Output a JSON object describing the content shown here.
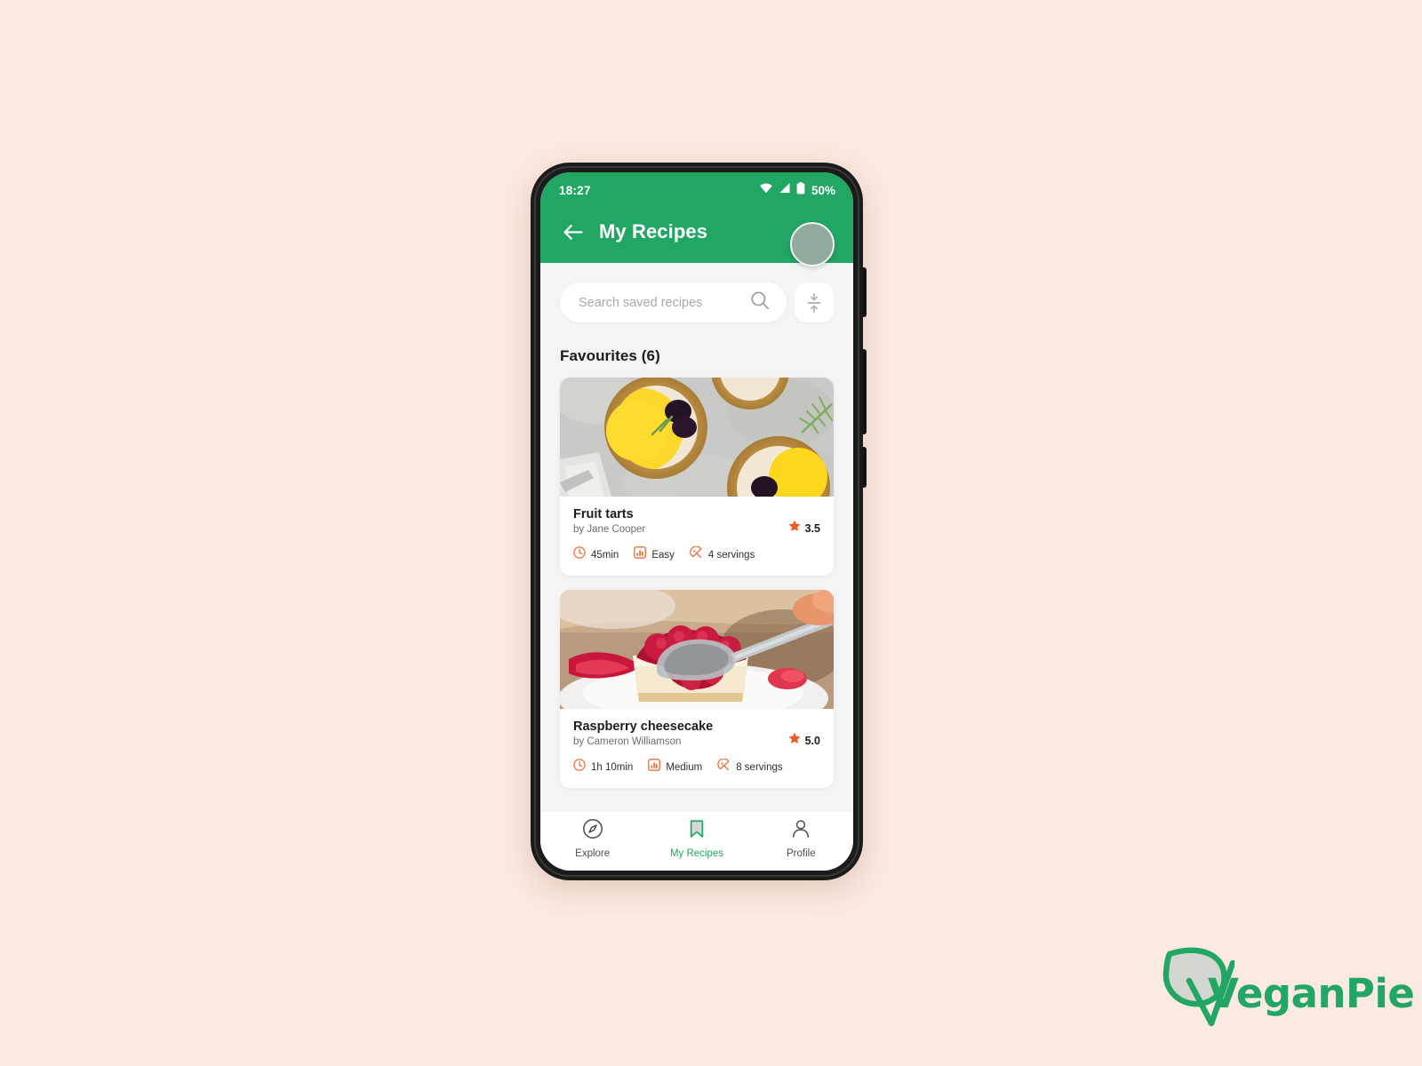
{
  "page": {
    "background_color": "#fce9e1"
  },
  "status_bar": {
    "time": "18:27",
    "battery_text": "50%",
    "icons": [
      "wifi-icon",
      "cellular-signal-icon",
      "battery-icon"
    ]
  },
  "appbar": {
    "title": "My Recipes",
    "back_icon": "arrow-left-icon",
    "avatar": "user-avatar",
    "background_color": "#22a664"
  },
  "search": {
    "placeholder": "Search saved recipes",
    "value": "",
    "icon": "search-icon",
    "sort_icon": "sort-arrows-icon"
  },
  "section": {
    "title": "Favourites (6)",
    "count": 6
  },
  "recipes": [
    {
      "title": "Fruit tarts",
      "author": "by Jane Cooper",
      "rating": "3.5",
      "time": "45min",
      "difficulty": "Easy",
      "servings": "4 servings",
      "photo": "fruit-tarts-photo"
    },
    {
      "title": "Raspberry cheesecake",
      "author": "by Cameron Williamson",
      "rating": "5.0",
      "time": "1h 10min",
      "difficulty": "Medium",
      "servings": "8 servings",
      "photo": "raspberry-cheesecake-photo"
    }
  ],
  "bottom_nav": {
    "items": [
      {
        "label": "Explore",
        "icon": "compass-icon",
        "active": false
      },
      {
        "label": "My Recipes",
        "icon": "bookmark-icon",
        "active": true
      },
      {
        "label": "Profile",
        "icon": "person-icon",
        "active": false
      }
    ],
    "active_color": "#22a664"
  },
  "logo": {
    "text": "VeganPie",
    "color": "#22a664",
    "mark": "leaf-icon"
  },
  "colors": {
    "brand_green": "#22a664",
    "accent_orange": "#f26b38",
    "star_orange": "#f1591f",
    "screen_bg": "#f4f4f4"
  }
}
